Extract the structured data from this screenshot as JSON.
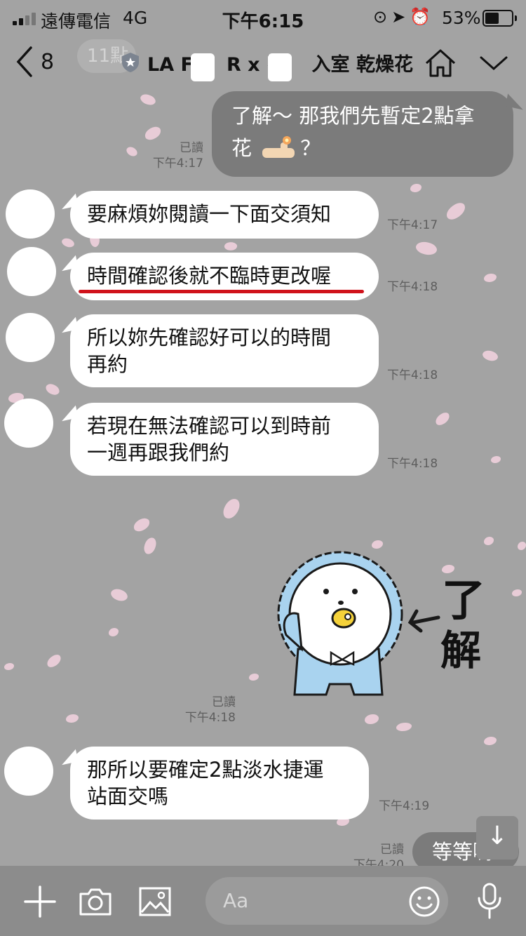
{
  "status_bar": {
    "carrier": "遠傳電信",
    "network": "4G",
    "time": "下午6:15",
    "icons": [
      "rotation-lock-icon",
      "location-arrow-icon",
      "alarm-icon"
    ],
    "battery_percent_label": "53%",
    "battery_level": 0.53
  },
  "header": {
    "back_count": "8",
    "ghost_tab": "11點",
    "title": "LA F     R x 引    入室 乾燥花",
    "icons": [
      "back-chevron-icon",
      "shield-icon",
      "home-icon",
      "chevron-down-icon"
    ]
  },
  "messages": [
    {
      "id": "m1",
      "direction": "out",
      "lines": [
        "了解～ 那我們先暫定2點拿",
        "花",
        "？"
      ],
      "read": "已讀",
      "time": "下午4:17"
    },
    {
      "id": "m2",
      "direction": "in",
      "text": "要麻煩妳閱讀一下面交須知",
      "time": "下午4:17"
    },
    {
      "id": "m3",
      "direction": "in",
      "text": "時間確認後就不臨時更改喔",
      "time": "下午4:18",
      "underlined": true
    },
    {
      "id": "m4",
      "direction": "in",
      "lines": [
        "所以妳先確認好可以的時間",
        "再約"
      ],
      "time": "下午4:18"
    },
    {
      "id": "m5",
      "direction": "in",
      "lines": [
        "若現在無法確認可以到時前",
        "一週再跟我們約"
      ],
      "time": "下午4:18"
    },
    {
      "id": "m6",
      "direction": "out",
      "type": "sticker",
      "sticker_text": [
        "了",
        "解"
      ],
      "read": "已讀",
      "time": "下午4:18"
    },
    {
      "id": "m7",
      "direction": "in",
      "lines": [
        "那所以要確定2點淡水捷運",
        "站面交嗎"
      ],
      "time": "下午4:19"
    },
    {
      "id": "m8",
      "direction": "out",
      "text": "等等喲",
      "read": "已讀",
      "time": "下午4:20"
    }
  ],
  "floating": {
    "scroll_down_icon": "arrow-down-icon"
  },
  "input_bar": {
    "placeholder": "Aa",
    "icons": [
      "plus-icon",
      "camera-icon",
      "image-icon",
      "emoji-icon",
      "microphone-icon"
    ]
  },
  "colors": {
    "underline": "#d0121b",
    "outgoing_bubble": "#7b7b7b",
    "petal": "#f4d3e0"
  }
}
